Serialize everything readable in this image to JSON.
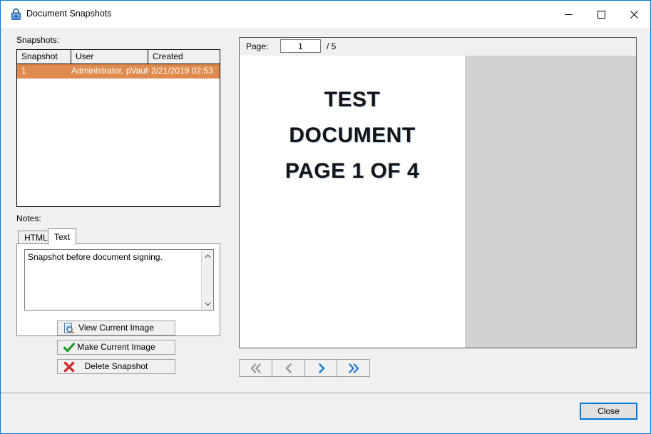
{
  "window": {
    "title": "Document Snapshots",
    "lock_icon": "lock-icon",
    "minimize_label": "–",
    "maximize_label": "□",
    "close_label": "✕"
  },
  "left_panel": {
    "snapshots_label": "Snapshots:",
    "notes_label": "Notes:",
    "list": {
      "columns": [
        "Snapshot",
        "User",
        "Created"
      ],
      "rows": [
        {
          "snapshot": "1",
          "user": "Administrator, pVault",
          "created": "2/21/2019 02:53",
          "selected": true
        }
      ],
      "selection_color": "#df8b4f",
      "selection_text_color": "#ffffff"
    },
    "tabs": [
      {
        "label": "HTML",
        "active": false
      },
      {
        "label": "Text",
        "active": true
      }
    ],
    "notes_text": "Snapshot before document signing.",
    "scrollbar": {
      "up_icon": "chevron-up-icon",
      "down_icon": "chevron-down-icon"
    },
    "buttons": [
      {
        "label": "View Current Image",
        "icon": "view-image-icon"
      },
      {
        "label": "Make Current Image",
        "icon": "green-check-icon"
      },
      {
        "label": "Delete Snapshot",
        "icon": "red-x-icon"
      }
    ]
  },
  "preview": {
    "page_label": "Page:",
    "page_value": "1",
    "page_total": "/ 5",
    "document_lines": [
      "TEST",
      "DOCUMENT",
      "PAGE 1 OF 4"
    ],
    "page_background": "#ffffff",
    "viewer_background": "#d1d1d1",
    "nav": [
      {
        "name": "first-page",
        "icon": "double-chevron-left-icon",
        "enabled": false
      },
      {
        "name": "previous-page",
        "icon": "chevron-left-icon",
        "enabled": false
      },
      {
        "name": "next-page",
        "icon": "chevron-right-icon",
        "enabled": true
      },
      {
        "name": "last-page",
        "icon": "double-chevron-right-icon",
        "enabled": true
      }
    ],
    "nav_enabled_color": "#1f7ed0",
    "nav_disabled_color": "#9a9a9a"
  },
  "footer": {
    "close_label": "Close",
    "accent_color": "#0078d7"
  }
}
